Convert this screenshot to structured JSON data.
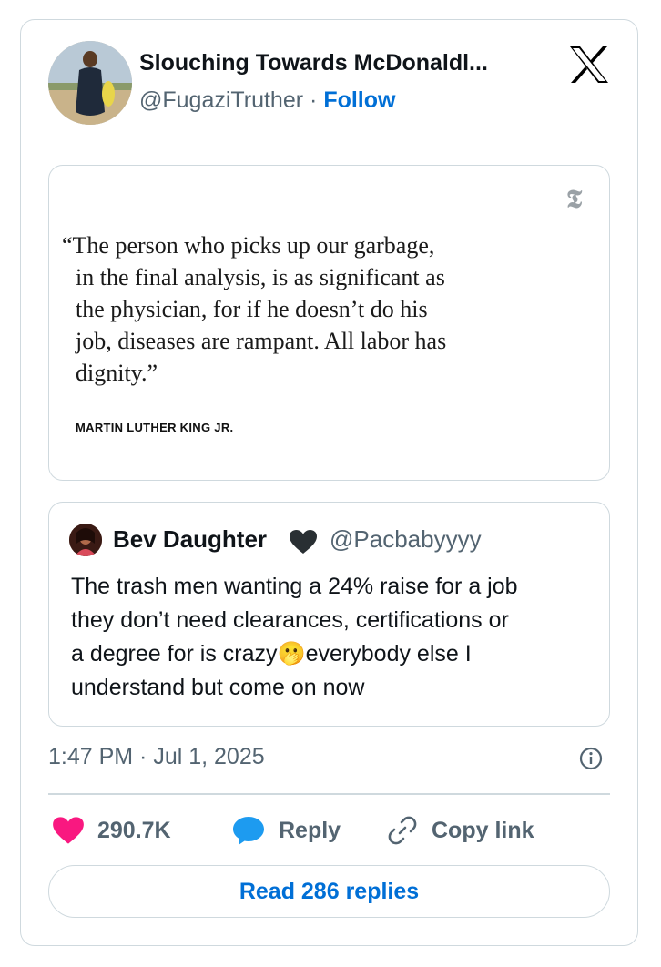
{
  "author": {
    "name": "Slouching Towards McDonaldl...",
    "handle": "@FugaziTruther",
    "separator": "·",
    "follow_label": "Follow"
  },
  "media": {
    "publisher_mark": "𝕿",
    "quote_lines": [
      "“The person who picks up our garbage,",
      "in the final analysis, is as significant as",
      "the physician, for if he doesn’t do his",
      "job, diseases are rampant. All labor has",
      "dignity.”"
    ],
    "attribution": "MARTIN LUTHER KING JR."
  },
  "quoted_tweet": {
    "name": "Bev Daughter",
    "name_emoji": "black-heart",
    "handle": "@Pacbabyyyy",
    "text_lines": [
      "The trash men wanting a 24% raise for a job",
      "they don’t need clearances, certifications or",
      "a degree for is crazy",
      "everybody else I",
      "understand but come on now"
    ],
    "inline_emoji": "🫢"
  },
  "timestamp": "1:47 PM · Jul 1, 2025",
  "actions": {
    "likes": "290.7K",
    "reply_label": "Reply",
    "copy_label": "Copy link"
  },
  "read_replies_label": "Read 286 replies",
  "colors": {
    "link": "#006fd6",
    "like_heart": "#f91880",
    "reply_bubble": "#1d9bf0",
    "muted_text": "#536471",
    "border": "#cfd9de"
  },
  "icons": [
    "x-logo-icon",
    "black-heart-icon",
    "info-icon",
    "heart-icon",
    "reply-bubble-icon",
    "link-icon"
  ]
}
